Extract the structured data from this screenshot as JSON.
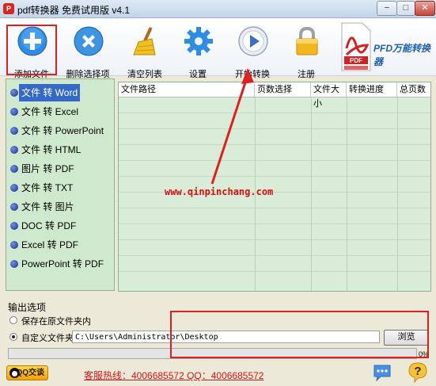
{
  "window": {
    "title": "pdf转换器 免费试用版 v4.1",
    "min": "−",
    "max": "□",
    "close": "✕"
  },
  "toolbar": [
    {
      "label": "添加文件",
      "icon": "add-file-icon"
    },
    {
      "label": "删除选择项",
      "icon": "delete-icon"
    },
    {
      "label": "清空列表",
      "icon": "broom-icon"
    },
    {
      "label": "设置",
      "icon": "gear-icon"
    },
    {
      "label": "开始转换",
      "icon": "play-icon"
    },
    {
      "label": "注册",
      "icon": "lock-icon"
    }
  ],
  "brand": {
    "text": "PFD万能转换器",
    "icon_text": "PDF"
  },
  "menu": [
    "文件 转 Word",
    "文件 转 Excel",
    "文件 转 PowerPoint",
    "文件 转 HTML",
    "图片 转 PDF",
    "文件 转 TXT",
    "文件 转 图片",
    "DOC 转 PDF",
    "Excel 转 PDF",
    "PowerPoint 转 PDF"
  ],
  "table": {
    "columns": [
      "文件路径",
      "页数选择",
      "文件大小",
      "转换进度",
      "总页数"
    ]
  },
  "watermark": "www.qinpinchang.com",
  "output": {
    "title": "输出选项",
    "opt_same": "保存在原文件夹内",
    "opt_custom": "自定义文件夹",
    "path": "C:\\Users\\Administrator\\Desktop",
    "browse": "浏览"
  },
  "progress": {
    "value": 0,
    "label": "0%"
  },
  "footer": {
    "qq": "QQ交谈",
    "hotline": "客服热线：4006685572 QQ：4006685572"
  },
  "colors": {
    "accent_red": "#e02020",
    "menu_bg": "#cfe9cf",
    "grid_bg": "#d8ecd8",
    "link_red": "#d61818"
  }
}
